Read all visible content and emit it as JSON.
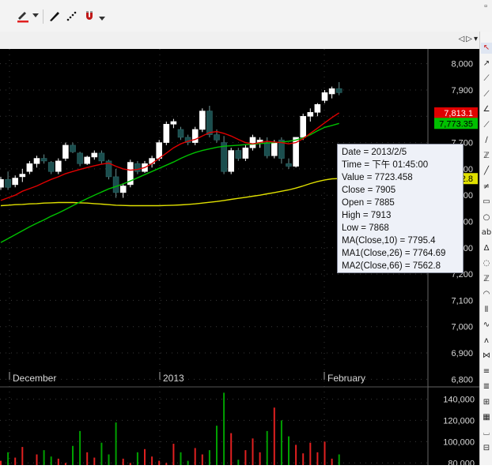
{
  "toolbar": {
    "icons": [
      "pen-color-icon",
      "dropdown-arrow-icon",
      "pencil-icon",
      "dotted-line-icon",
      "magnet-icon",
      "overflow-arrow-icon"
    ],
    "accent": "#e02020"
  },
  "panel": {
    "nav_prev": "◁",
    "nav_next": "▷",
    "menu": "▾"
  },
  "chart_data": {
    "type": "candlestick",
    "price_ticks": [
      "8,000",
      "7,900",
      "7,800",
      "7,700",
      "7,600",
      "7,500",
      "7,400",
      "7,300",
      "7,200",
      "7,100",
      "7,000",
      "6,900",
      "6,800"
    ],
    "price_range": [
      6750,
      8020
    ],
    "x_labels": [
      "December",
      "2013",
      "February"
    ],
    "last_value_labels": [
      {
        "text": "7,813.1",
        "color": "#e00000",
        "series": "MA(Close,10)"
      },
      {
        "text": "7,773.35",
        "color": "#00c000",
        "series": "MA1(Close,26)"
      },
      {
        "text": "7,562.8",
        "color": "#e0e000",
        "series": "MA2(Close,66)"
      }
    ],
    "candles": [
      [
        7530,
        7570,
        7520,
        7560
      ],
      [
        7560,
        7590,
        7520,
        7530
      ],
      [
        7540,
        7575,
        7530,
        7565
      ],
      [
        7570,
        7600,
        7550,
        7580
      ],
      [
        7590,
        7630,
        7580,
        7620
      ],
      [
        7620,
        7650,
        7605,
        7640
      ],
      [
        7640,
        7655,
        7620,
        7630
      ],
      [
        7625,
        7630,
        7580,
        7590
      ],
      [
        7590,
        7640,
        7580,
        7630
      ],
      [
        7640,
        7700,
        7630,
        7690
      ],
      [
        7690,
        7700,
        7660,
        7665
      ],
      [
        7660,
        7665,
        7610,
        7620
      ],
      [
        7620,
        7650,
        7615,
        7645
      ],
      [
        7645,
        7670,
        7635,
        7660
      ],
      [
        7660,
        7670,
        7620,
        7630
      ],
      [
        7630,
        7635,
        7560,
        7570
      ],
      [
        7570,
        7600,
        7490,
        7510
      ],
      [
        7510,
        7545,
        7490,
        7535
      ],
      [
        7540,
        7635,
        7530,
        7625
      ],
      [
        7620,
        7630,
        7580,
        7590
      ],
      [
        7590,
        7630,
        7585,
        7620
      ],
      [
        7620,
        7650,
        7605,
        7640
      ],
      [
        7640,
        7710,
        7630,
        7700
      ],
      [
        7700,
        7780,
        7690,
        7770
      ],
      [
        7770,
        7790,
        7755,
        7780
      ],
      [
        7750,
        7760,
        7710,
        7720
      ],
      [
        7720,
        7730,
        7690,
        7700
      ],
      [
        7700,
        7760,
        7690,
        7750
      ],
      [
        7750,
        7830,
        7740,
        7820
      ],
      [
        7820,
        7840,
        7720,
        7730
      ],
      [
        7730,
        7750,
        7700,
        7710
      ],
      [
        7700,
        7725,
        7580,
        7590
      ],
      [
        7590,
        7680,
        7580,
        7670
      ],
      [
        7670,
        7680,
        7630,
        7640
      ],
      [
        7640,
        7690,
        7630,
        7680
      ],
      [
        7680,
        7730,
        7670,
        7720
      ],
      [
        7700,
        7720,
        7680,
        7710
      ],
      [
        7700,
        7720,
        7640,
        7650
      ],
      [
        7650,
        7710,
        7640,
        7700
      ],
      [
        7710,
        7720,
        7620,
        7640
      ],
      [
        7620,
        7640,
        7600,
        7610
      ],
      [
        7610,
        7720,
        7605,
        7720
      ],
      [
        7720,
        7810,
        7710,
        7800
      ],
      [
        7800,
        7830,
        7780,
        7815
      ],
      [
        7815,
        7850,
        7800,
        7845
      ],
      [
        7860,
        7900,
        7850,
        7890
      ],
      [
        7885,
        7913,
        7868,
        7905
      ],
      [
        7905,
        7930,
        7880,
        7890
      ]
    ],
    "ma_close_10": [
      7480,
      7490,
      7500,
      7515,
      7525,
      7535,
      7548,
      7560,
      7570,
      7582,
      7590,
      7598,
      7605,
      7612,
      7618,
      7622,
      7610,
      7600,
      7595,
      7598,
      7605,
      7620,
      7640,
      7660,
      7680,
      7695,
      7705,
      7712,
      7725,
      7738,
      7742,
      7735,
      7725,
      7712,
      7700,
      7695,
      7700,
      7705,
      7702,
      7700,
      7695,
      7700,
      7715,
      7735,
      7755,
      7775,
      7795,
      7813
    ],
    "ma1_close_26": [
      7320,
      7335,
      7350,
      7365,
      7380,
      7393,
      7406,
      7420,
      7432,
      7446,
      7460,
      7474,
      7487,
      7500,
      7512,
      7524,
      7533,
      7543,
      7554,
      7566,
      7578,
      7590,
      7602,
      7614,
      7626,
      7640,
      7652,
      7662,
      7670,
      7676,
      7682,
      7686,
      7688,
      7690,
      7692,
      7694,
      7696,
      7698,
      7700,
      7702,
      7705,
      7710,
      7718,
      7730,
      7745,
      7758,
      7765,
      7773
    ],
    "ma2_close_66": [
      7460,
      7462,
      7464,
      7465,
      7467,
      7468,
      7470,
      7471,
      7472,
      7472,
      7472,
      7471,
      7470,
      7468,
      7466,
      7464,
      7462,
      7461,
      7460,
      7460,
      7460,
      7460,
      7460,
      7461,
      7462,
      7463,
      7465,
      7467,
      7470,
      7473,
      7476,
      7480,
      7484,
      7488,
      7492,
      7496,
      7500,
      7505,
      7510,
      7515,
      7520,
      7527,
      7535,
      7544,
      7552,
      7558,
      7562,
      7563
    ],
    "volume_ticks": [
      "140,000",
      "120,000",
      "100,000",
      "80,000"
    ],
    "volume_range": [
      78000,
      150000
    ],
    "volume": [
      82000,
      90000,
      85000,
      95000,
      78000,
      88000,
      92000,
      86000,
      84000,
      80000,
      96000,
      110000,
      90000,
      85000,
      99000,
      88000,
      118000,
      84000,
      80000,
      90000,
      93000,
      86000,
      82000,
      80000,
      98000,
      90000,
      82000,
      94000,
      88000,
      92000,
      115000,
      146000,
      108000,
      83000,
      92000,
      103000,
      90000,
      110000,
      132000,
      120000,
      105000,
      97000,
      89000,
      99000,
      90000,
      100000,
      84000,
      88000
    ]
  },
  "tooltip": {
    "date": "Date = 2013/2/5",
    "time": "Time = 下午 01:45:00",
    "value": "Value = 7723.458",
    "close": "Close = 7905",
    "open": "Open = 7885",
    "high": "High = 7913",
    "low": "Low = 7868",
    "ma": "MA(Close,10) = 7795.4",
    "ma1": "MA1(Close,26) = 7764.69",
    "ma2": "MA2(Close,66) = 7562.8"
  },
  "right_toolbar": {
    "icons": [
      "select-arrow-icon",
      "line-icon",
      "ray-icon",
      "polyline-icon",
      "channel-icon",
      "parallel-icon",
      "arrow-icon",
      "fan-icon",
      "trend-icon",
      "grid-icon",
      "rect-icon",
      "circle-icon",
      "text-icon",
      "triangle-icon",
      "ellipse-icon",
      "fib-icon",
      "arc-icon",
      "cycle-icon",
      "wave-icon",
      "zigzag-icon",
      "pitchfork-icon",
      "lines-icon",
      "bars-icon",
      "gann-icon",
      "box-icon",
      "shift-icon",
      "table-icon"
    ],
    "glyphs": [
      "↖",
      "↗",
      "⟋",
      "⟋",
      "∠",
      "⟋",
      "∕",
      "ℤ",
      "╱",
      "≠",
      "▭",
      "○",
      "ab",
      "Δ",
      "◌",
      "ℤ",
      "◠",
      "⫴",
      "∿",
      "ʌ",
      "⋈",
      "≡",
      "≣",
      "⊞",
      "▦",
      "⌴",
      "⊟"
    ]
  },
  "colors": {
    "up": "#ffffff",
    "down": "#1b4e4e",
    "ma": "#e00000",
    "ma1": "#00c000",
    "ma2": "#e0e000",
    "vol_up": "#e02020",
    "vol_down": "#00a000",
    "grid": "#3a3a3a"
  }
}
